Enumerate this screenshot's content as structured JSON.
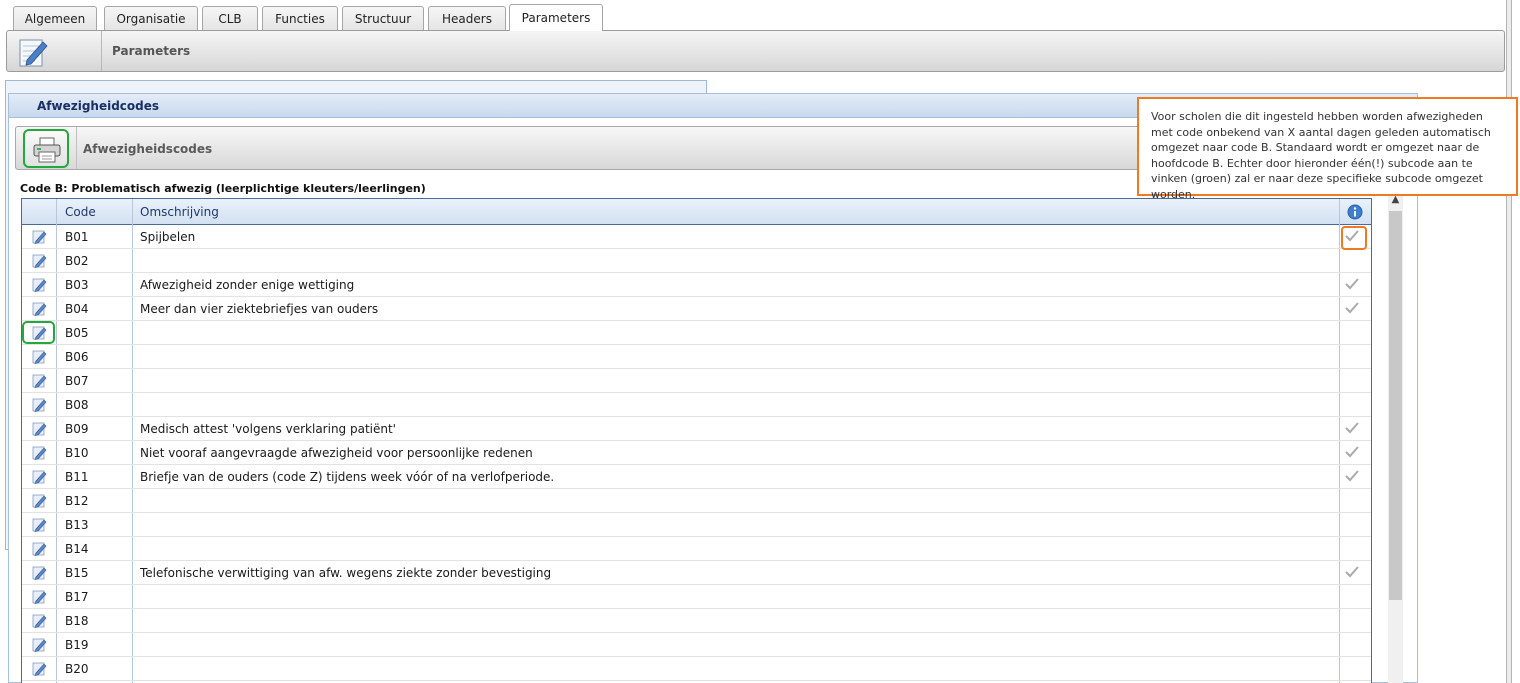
{
  "tabs": [
    {
      "label": "Algemeen",
      "active": false
    },
    {
      "label": "Organisatie",
      "active": false
    },
    {
      "label": "CLB",
      "active": false
    },
    {
      "label": "Functies",
      "active": false
    },
    {
      "label": "Structuur",
      "active": false
    },
    {
      "label": "Headers",
      "active": false
    },
    {
      "label": "Parameters",
      "active": true
    }
  ],
  "header": {
    "title": "Parameters",
    "icon": "notepad-pencil-icon"
  },
  "panel": {
    "title": "Afwezigheidcodes",
    "subtitle": "Afwezigheidscodes",
    "print_icon": "printer-icon",
    "code_label": "Code B: Problematisch afwezig (leerplichtige kleuters/leerlingen)"
  },
  "grid": {
    "columns": {
      "code": "Code",
      "description": "Omschrijving",
      "info_icon": "info-icon"
    },
    "rows": [
      {
        "code": "B01",
        "description": "Spijbelen",
        "checked": true
      },
      {
        "code": "B02",
        "description": "",
        "checked": false
      },
      {
        "code": "B03",
        "description": "Afwezigheid zonder enige wettiging",
        "checked": true
      },
      {
        "code": "B04",
        "description": "Meer dan vier ziektebriefjes van ouders",
        "checked": true
      },
      {
        "code": "B05",
        "description": "",
        "checked": false
      },
      {
        "code": "B06",
        "description": "",
        "checked": false
      },
      {
        "code": "B07",
        "description": "",
        "checked": false
      },
      {
        "code": "B08",
        "description": "",
        "checked": false
      },
      {
        "code": "B09",
        "description": "Medisch attest 'volgens verklaring patiënt'",
        "checked": true
      },
      {
        "code": "B10",
        "description": "Niet vooraf aangevraagde afwezigheid voor persoonlijke redenen",
        "checked": true
      },
      {
        "code": "B11",
        "description": "Briefje van de ouders (code Z) tijdens week vóór of na verlofperiode.",
        "checked": true
      },
      {
        "code": "B12",
        "description": "",
        "checked": false
      },
      {
        "code": "B13",
        "description": "",
        "checked": false
      },
      {
        "code": "B14",
        "description": "",
        "checked": false
      },
      {
        "code": "B15",
        "description": "Telefonische verwittiging van afw. wegens ziekte zonder bevestiging",
        "checked": true
      },
      {
        "code": "B17",
        "description": "",
        "checked": false
      },
      {
        "code": "B18",
        "description": "",
        "checked": false
      },
      {
        "code": "B19",
        "description": "",
        "checked": false
      },
      {
        "code": "B20",
        "description": "",
        "checked": false
      }
    ]
  },
  "tooltip": {
    "text": "Voor scholen die dit ingesteld hebben worden afwezigheden met code onbekend van X aantal dagen geleden automatisch omgezet naar code B.  Standaard wordt er omgezet naar de hoofdcode B. Echter door hieronder één(!) subcode aan te vinken (groen) zal er naar deze specifieke subcode omgezet worden."
  },
  "colors": {
    "highlight_green": "#24a83d",
    "highlight_orange": "#ee7b24",
    "header_blue": "#1a2f63"
  }
}
